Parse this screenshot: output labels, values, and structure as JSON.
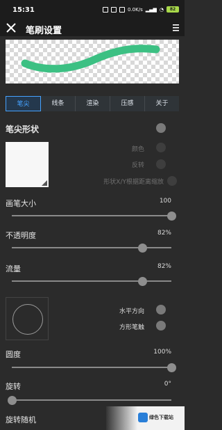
{
  "status": {
    "time": "15:31",
    "network": "0.0K/s",
    "battery": "82"
  },
  "header": {
    "title": "笔刷设置"
  },
  "tabs": [
    {
      "label": "笔尖",
      "active": true
    },
    {
      "label": "线条",
      "active": false
    },
    {
      "label": "渲染",
      "active": false
    },
    {
      "label": "压感",
      "active": false
    },
    {
      "label": "关于",
      "active": false
    }
  ],
  "tip": {
    "section_title": "笔尖形状",
    "color_label": "颜色",
    "invert_label": "反转",
    "spacing_label": "形状X/Y根据距离缩放"
  },
  "settings": {
    "size": {
      "label": "画笔大小",
      "value": "100",
      "fraction": 1.0
    },
    "opacity": {
      "label": "不透明度",
      "value": "82%",
      "fraction": 0.82
    },
    "flow": {
      "label": "流量",
      "value": "82%",
      "fraction": 0.82
    },
    "flip_h_label": "水平方向",
    "shape_label": "方形笔触",
    "roundness": {
      "label": "圆度",
      "value": "100%",
      "fraction": 1.0
    },
    "rotation": {
      "label": "旋转",
      "value": "0°",
      "fraction": 0.0
    },
    "rotation_random": {
      "label": "旋转随机"
    }
  },
  "watermark": {
    "text": "绿色下载站"
  },
  "colors": {
    "accent": "#46a2ff",
    "stroke": "#3cc083",
    "background": "#2b2b2b"
  }
}
